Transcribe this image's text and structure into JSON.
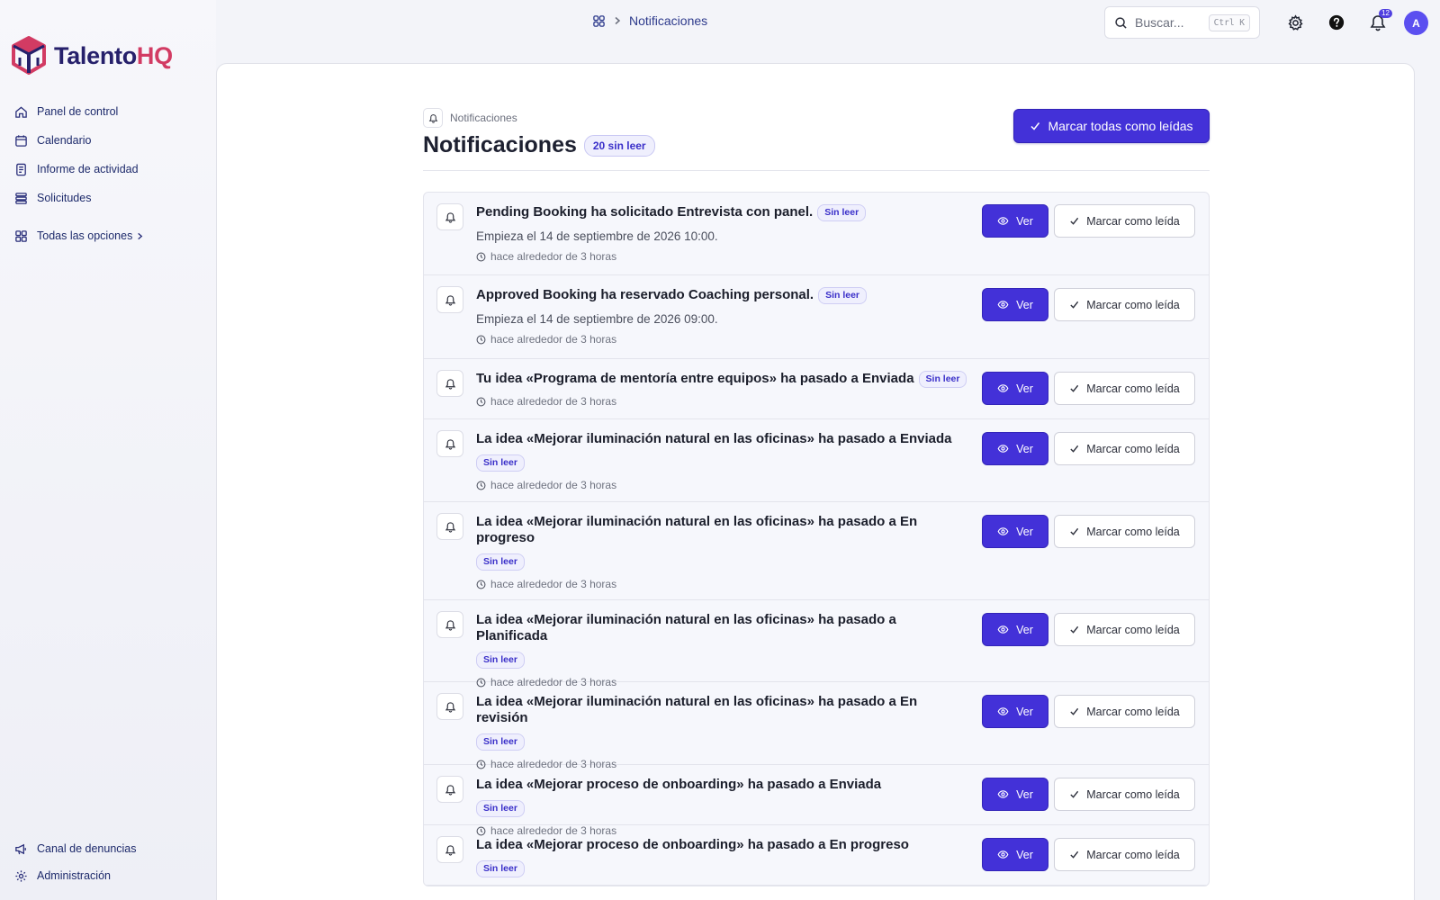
{
  "brand": {
    "name_part1": "Talento",
    "name_part2": "HQ"
  },
  "sidebar": {
    "items": [
      {
        "label": "Panel de control",
        "icon": "home-icon"
      },
      {
        "label": "Calendario",
        "icon": "calendar-icon"
      },
      {
        "label": "Informe de actividad",
        "icon": "report-icon"
      },
      {
        "label": "Solicitudes",
        "icon": "list-icon"
      }
    ],
    "all_options": "Todas las opciones",
    "bottom": [
      {
        "label": "Canal de denuncias",
        "icon": "megaphone-icon"
      },
      {
        "label": "Administración",
        "icon": "gear-icon"
      }
    ]
  },
  "topbar": {
    "breadcrumb": "Notificaciones",
    "search_placeholder": "Buscar...",
    "search_shortcut": "Ctrl K",
    "notification_count": "12",
    "avatar_initial": "A"
  },
  "page": {
    "crumb": "Notificaciones",
    "title": "Notificaciones",
    "unread_badge": "20 sin leer",
    "mark_all_label": "Marcar todas como leídas"
  },
  "buttons": {
    "view": "Ver",
    "mark_read": "Marcar como leída",
    "unread_tag": "Sin leer"
  },
  "notifications": [
    {
      "title": "Pending Booking ha solicitado Entrevista con panel.",
      "subtitle": "Empieza el 14 de septiembre de 2026 10:00.",
      "time": "hace alrededor de 3 horas"
    },
    {
      "title": "Approved Booking ha reservado Coaching personal.",
      "subtitle": "Empieza el 14 de septiembre de 2026 09:00.",
      "time": "hace alrededor de 3 horas"
    },
    {
      "title": "Tu idea «Programa de mentoría entre equipos» ha pasado a Enviada",
      "subtitle": "",
      "time": "hace alrededor de 3 horas"
    },
    {
      "title": "La idea «Mejorar iluminación natural en las oficinas» ha pasado a Enviada",
      "subtitle": "",
      "time": "hace alrededor de 3 horas"
    },
    {
      "title": "La idea «Mejorar iluminación natural en las oficinas» ha pasado a En progreso",
      "subtitle": "",
      "time": "hace alrededor de 3 horas"
    },
    {
      "title": "La idea «Mejorar iluminación natural en las oficinas» ha pasado a Planificada",
      "subtitle": "",
      "time": "hace alrededor de 3 horas"
    },
    {
      "title": "La idea «Mejorar iluminación natural en las oficinas» ha pasado a En revisión",
      "subtitle": "",
      "time": "hace alrededor de 3 horas"
    },
    {
      "title": "La idea «Mejorar proceso de onboarding» ha pasado a Enviada",
      "subtitle": "",
      "time": "hace alrededor de 3 horas"
    },
    {
      "title": "La idea «Mejorar proceso de onboarding» ha pasado a En progreso",
      "subtitle": "",
      "time": "hace alrededor de 3 horas"
    }
  ],
  "colors": {
    "accent": "#4331d8",
    "brand_dark": "#26206b",
    "brand_red": "#d23b63"
  }
}
